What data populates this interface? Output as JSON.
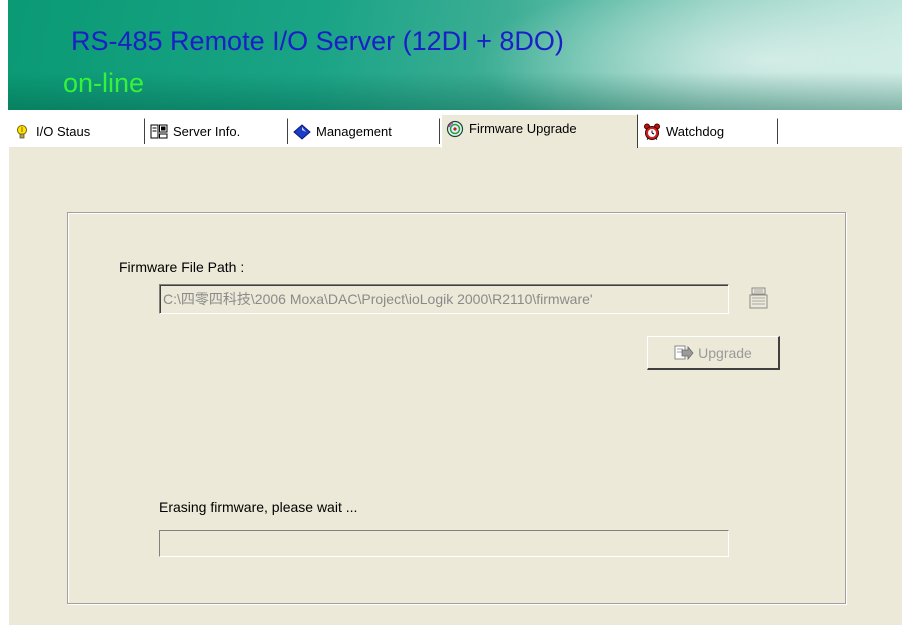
{
  "header": {
    "title": "RS-485 Remote I/O Server (12DI + 8DO)",
    "status": "on-line",
    "status_color": "#36f23a",
    "title_color": "#1a1fc8"
  },
  "tabs": [
    {
      "label": "I/O Staus",
      "icon": "lightbulb-icon",
      "active": false
    },
    {
      "label": "Server Info.",
      "icon": "server-icon",
      "active": false
    },
    {
      "label": "Management",
      "icon": "diamond-icon",
      "active": false
    },
    {
      "label": "Firmware Upgrade",
      "icon": "disc-icon",
      "active": true
    },
    {
      "label": "Watchdog",
      "icon": "alarm-clock-icon",
      "active": false
    }
  ],
  "firmware": {
    "path_label": "Firmware File Path :",
    "path_value": "C:\\四零四科技\\2006 Moxa\\DAC\\Project\\ioLogik 2000\\R2110\\firmware'",
    "browse_icon": "browse-file-icon",
    "upgrade_label": "Upgrade",
    "upgrade_icon": "upgrade-arrow-icon",
    "status_text": "Erasing firmware, please wait ...",
    "progress": 0
  }
}
